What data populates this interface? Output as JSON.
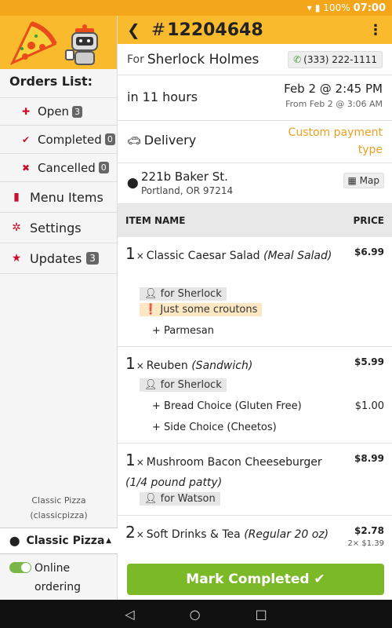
{
  "status_bar": {
    "battery": "100%",
    "time": "07:00"
  },
  "sidebar": {
    "orders_title": "Orders List:",
    "orders": [
      {
        "label": "Open",
        "count": "3"
      },
      {
        "label": "Completed",
        "count": "0"
      },
      {
        "label": "Cancelled",
        "count": "0"
      }
    ],
    "menu_items": "Menu Items",
    "settings": "Settings",
    "updates": "Updates",
    "updates_count": "3",
    "store_caption_name": "Classic Pizza",
    "store_caption_id": "(classicpizza)",
    "store_select": "Classic Pizza",
    "online_label": "Online ordering"
  },
  "order": {
    "number": "12204648",
    "for_label": "For",
    "customer": "Sherlock Holmes",
    "phone": "(333) 222-1111",
    "eta": "in 11 hours",
    "time": "Feb 2 @ 2:45 PM",
    "time_from": "From Feb 2 @ 3:06 AM",
    "delivery": "Delivery",
    "payment_type": "Custom payment type",
    "address_line1": "221b Baker St.",
    "address_line2": "Portland, OR 97214",
    "map_label": "Map",
    "col_item": "ITEM NAME",
    "col_price": "PRICE",
    "items": [
      {
        "qty": "1",
        "name": "Classic Caesar Salad",
        "category": "(Meal Salad)",
        "price": "$6.99",
        "for": "for Sherlock",
        "note": "Just some croutons",
        "mods": [
          {
            "label": "Parmesan",
            "price": ""
          }
        ]
      },
      {
        "qty": "1",
        "name": "Reuben",
        "category": "(Sandwich)",
        "price": "$5.99",
        "for": "for Sherlock",
        "mods": [
          {
            "label": "Bread Choice (Gluten Free)",
            "price": "$1.00"
          },
          {
            "label": "Side Choice (Cheetos)",
            "price": ""
          }
        ]
      },
      {
        "qty": "1",
        "name": "Mushroom Bacon Cheeseburger",
        "category": "(1/4 pound patty)",
        "price": "$8.99",
        "for": "for Watson"
      },
      {
        "qty": "2",
        "name": "Soft Drinks & Tea",
        "category": "(Regular 20 oz)",
        "price": "$2.78",
        "subprice": "2× $1.39"
      }
    ],
    "mark_completed": "Mark Completed"
  }
}
